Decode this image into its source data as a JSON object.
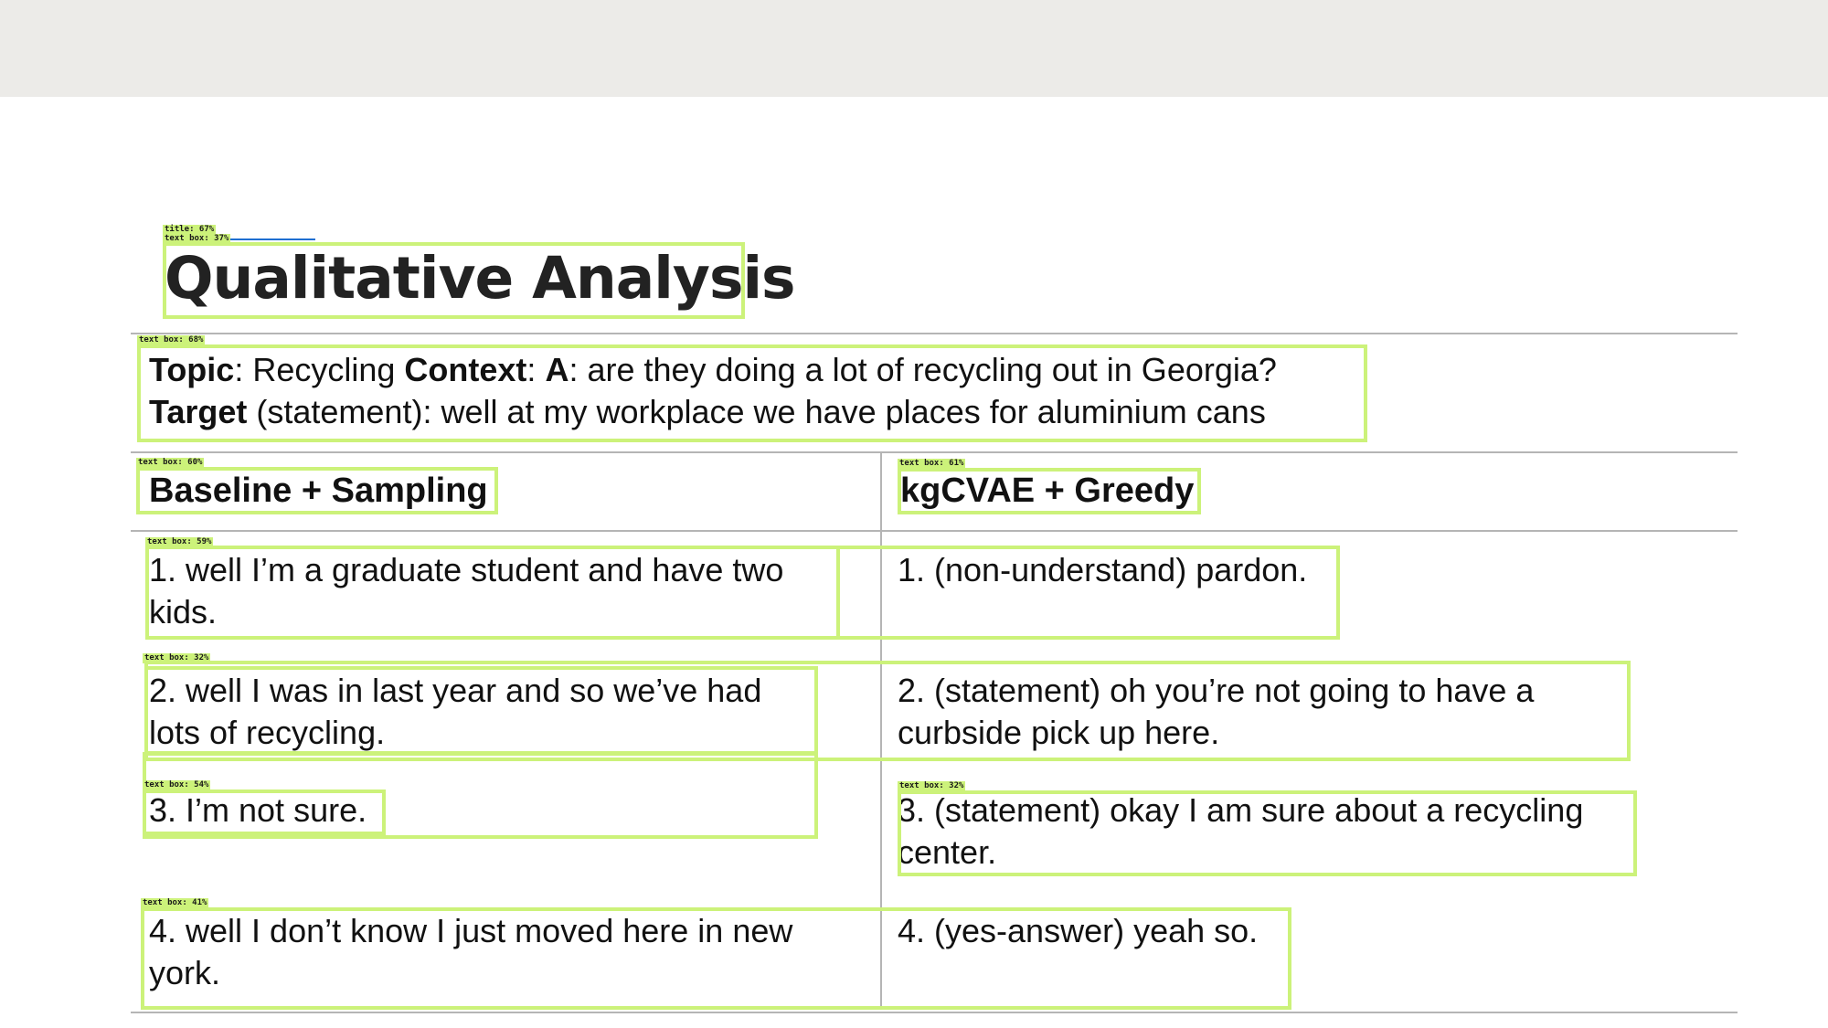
{
  "slide": {
    "title": "Qualitative Analysis",
    "context": {
      "topic_label": "Topic",
      "topic_value": "Recycling",
      "context_label": "Context",
      "speaker_label": "A",
      "context_value": "are they doing a lot of recycling out in Georgia?",
      "target_label": "Target",
      "target_type": "(statement)",
      "target_value": "well at my workplace we have places for aluminium cans"
    },
    "table": {
      "columns": [
        "Baseline + Sampling",
        "kgCVAE + Greedy"
      ],
      "rows": [
        {
          "baseline": [
            "1.  well I’m a graduate student and have two",
            "kids."
          ],
          "kgcvae": [
            "1. (non-understand) pardon."
          ]
        },
        {
          "baseline": [
            "2. well I was in last year and so we’ve had",
            "lots of recycling."
          ],
          "kgcvae": [
            "2. (statement) oh you’re not going to have a",
            "curbside pick up here."
          ]
        },
        {
          "baseline": [
            "3. I’m not sure."
          ],
          "kgcvae": [
            "3. (statement) okay I am sure about a recycling",
            "center."
          ]
        },
        {
          "baseline": [
            "4. well I don’t know I just moved here in new",
            "york."
          ],
          "kgcvae": [
            "4. (yes-answer) yeah so."
          ]
        }
      ]
    }
  },
  "detections": [
    {
      "label": "title: 67%"
    },
    {
      "label": "text box: 37%"
    },
    {
      "label": "text box: 68%"
    },
    {
      "label": "text box: 60%"
    },
    {
      "label": "text box: 61%"
    },
    {
      "label": "text box: 59%"
    },
    {
      "label": "text box: 32%"
    },
    {
      "label": "text box: 54%"
    },
    {
      "label": "text box: 32%"
    },
    {
      "label": "text box: 41%"
    }
  ],
  "colors": {
    "detection_box": "#ccf27a",
    "title_accent": "#1f6fd1",
    "top_bar": "#ecebe8"
  }
}
